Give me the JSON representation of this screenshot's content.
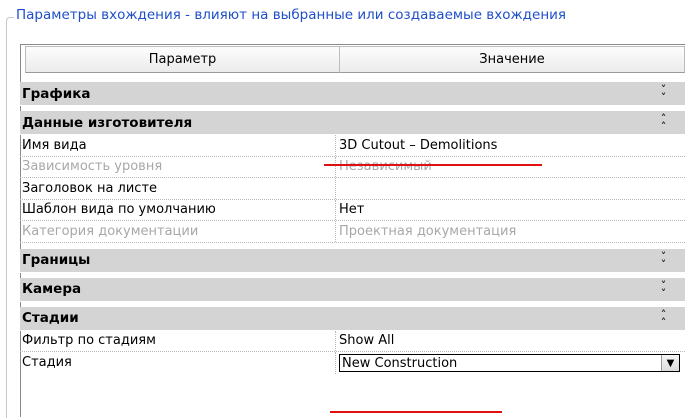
{
  "groupbox": {
    "title": "Параметры вхождения - влияют на выбранные или создаваемые вхождения"
  },
  "table": {
    "header_param": "Параметр",
    "header_value": "Значение"
  },
  "categories": {
    "graphics": "Графика",
    "identity": "Данные изготовителя",
    "extents": "Границы",
    "camera": "Камера",
    "phasing": "Стадии"
  },
  "props": {
    "view_name": {
      "name": "Имя вида",
      "value": "3D Cutout – Demolitions"
    },
    "dependency": {
      "name": "Зависимость уровня",
      "value": "Независимый"
    },
    "title_on_sheet": {
      "name": "Заголовок на листе",
      "value": ""
    },
    "default_template": {
      "name": "Шаблон вида по умолчанию",
      "value": "Нет"
    },
    "doc_category": {
      "name": "Категория документации",
      "value": "Проектная документация"
    },
    "phase_filter": {
      "name": "Фильтр по стадиям",
      "value": "Show All"
    },
    "phase": {
      "name": "Стадия",
      "value": "New Construction"
    }
  },
  "icons": {
    "expand": "chevron-double-down-icon",
    "collapse": "chevron-double-up-icon",
    "dropdown": "dropdown-arrow-icon"
  },
  "colors": {
    "title_blue": "#1f4fc8",
    "category_bg": "#d4d4d4",
    "highlight_red": "#e01010",
    "disabled_text": "#a8a8a8"
  }
}
